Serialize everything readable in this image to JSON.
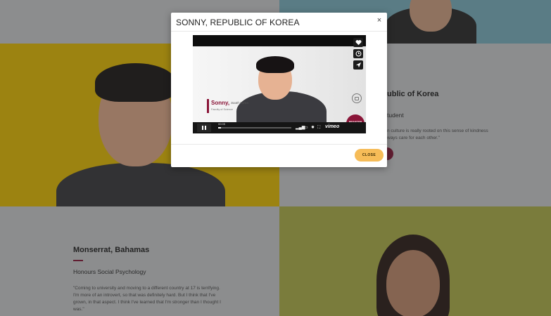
{
  "modal": {
    "title": "SONNY, REPUBLIC OF KOREA",
    "close_x": "×",
    "close_button_label": "CLOSE"
  },
  "video": {
    "lower_third_name": "Sonny,",
    "lower_third_country": "South Korea",
    "lower_third_subtitle": "Faculty of Science",
    "brand_badge": "REGISTER NOW",
    "time": "00:05",
    "progress": 0.04,
    "player_brand": "vimeo",
    "side_buttons": [
      "heart-icon",
      "clock-icon",
      "send-icon"
    ]
  },
  "background": {
    "top_right_profile": {
      "name_partial": "ublic of Korea",
      "program_partial": "tudent",
      "quote_partial": "n culture is really rooted on this sense of kindness\nways care for each other.\""
    },
    "bottom_left_profile": {
      "name": "Monserrat, Bahamas",
      "program": "Honours Social Psychology",
      "quote": "\"Coming to university and moving to a different country at 17 is terrifying. I'm more of an introvert, so that was definitely hard. But I think that I've grown, in that aspect. I think I've learned that I'm stronger than I thought I was.\""
    }
  },
  "colors": {
    "accent": "#8a1538",
    "close_button": "#f6bc58",
    "yellow_tile": "#f0c400",
    "olive_tile": "#b6b84a"
  }
}
